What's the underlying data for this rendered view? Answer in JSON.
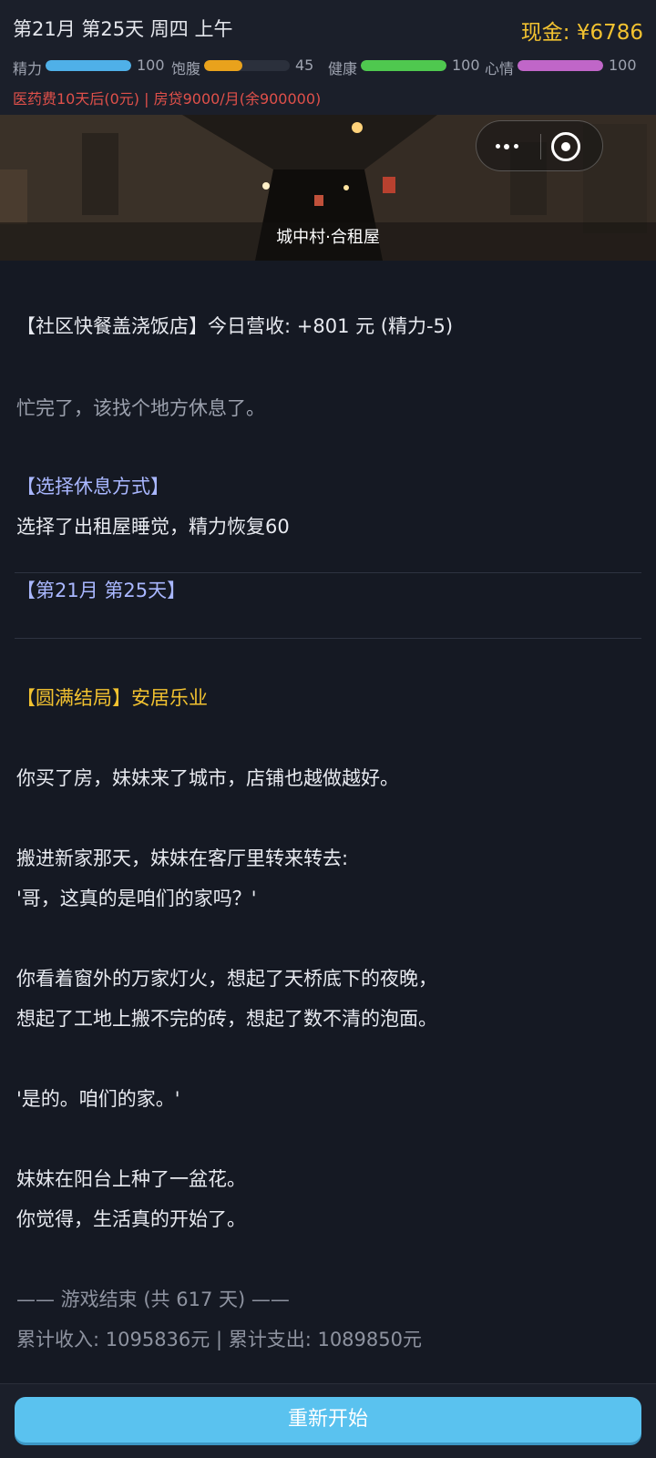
{
  "header": {
    "date_line": "第21月 第25天 周四 上午",
    "cash": "现金: ¥6786",
    "stats": [
      {
        "label": "精力",
        "value": "100",
        "level": 1.0,
        "color": "#4fb0e8"
      },
      {
        "label": "饱腹",
        "value": "45",
        "level": 0.45,
        "color": "#e9a21c"
      },
      {
        "label": "健康",
        "value": "100",
        "level": 1.0,
        "color": "#4fc84f"
      },
      {
        "label": "心情",
        "value": "100",
        "level": 1.0,
        "color": "#c066c8"
      }
    ],
    "alert": "医药费10天后(0元) | 房贷9000/月(余900000)"
  },
  "banner": {
    "location": "城中村·合租屋"
  },
  "story": {
    "l1": "【社区快餐盖浇饭店】今日营收: +801 元 (精力-5)",
    "l2": "忙完了，该找个地方休息了。",
    "l3": "【选择休息方式】",
    "l4": "选择了出租屋睡觉，精力恢复60",
    "l5": "【第21月 第25天】",
    "l6": "【圆满结局】安居乐业",
    "l7": "你买了房，妹妹来了城市，店铺也越做越好。",
    "l8": "搬进新家那天，妹妹在客厅里转来转去:",
    "l9": "'哥，这真的是咱们的家吗？'",
    "l10": "你看着窗外的万家灯火，想起了天桥底下的夜晚，",
    "l11": "想起了工地上搬不完的砖，想起了数不清的泡面。",
    "l12": "'是的。咱们的家。'",
    "l13": "妹妹在阳台上种了一盆花。",
    "l14": "你觉得，生活真的开始了。",
    "l15": "—— 游戏结束 (共 617 天) ——",
    "l16": "累计收入: 1095836元 | 累计支出: 1089850元"
  },
  "footer": {
    "restart_label": "重新开始"
  }
}
